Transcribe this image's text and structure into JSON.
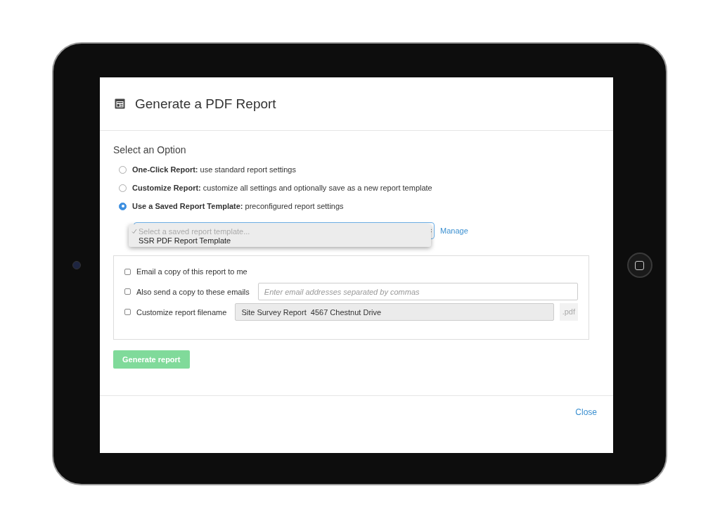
{
  "dialog": {
    "title": "Generate a PDF Report",
    "section_title": "Select an Option",
    "options": [
      {
        "text": "**One-Click Report:** use standard report settings",
        "selected": false
      },
      {
        "text": "**Customize Report:** customize all settings and optionally save as a new report template",
        "selected": false
      },
      {
        "text": "**Use a Saved Report Template:** preconfigured report settings",
        "selected": true
      }
    ],
    "template_select": {
      "options": [
        {
          "label": "Select a saved report template...",
          "selected": true
        },
        {
          "label": "SSR PDF Report Template",
          "selected": false
        }
      ]
    },
    "manage_link": "Manage",
    "delivery": [
      {
        "label": "Email a copy of this report to me",
        "checked": false
      },
      {
        "label": "Also send a copy to these emails",
        "checked": false,
        "field": {
          "placeholder": "Enter email addresses separated by commas",
          "disabled": false
        }
      },
      {
        "label": "Customize report filename",
        "checked": false,
        "field": {
          "value": "Site Survey Report  4567 Chestnut Drive",
          "disabled": true,
          "suffix": ".pdf"
        }
      }
    ],
    "generate_button": {
      "label": "Generate report",
      "disabled": true
    },
    "close_link": "Close"
  }
}
